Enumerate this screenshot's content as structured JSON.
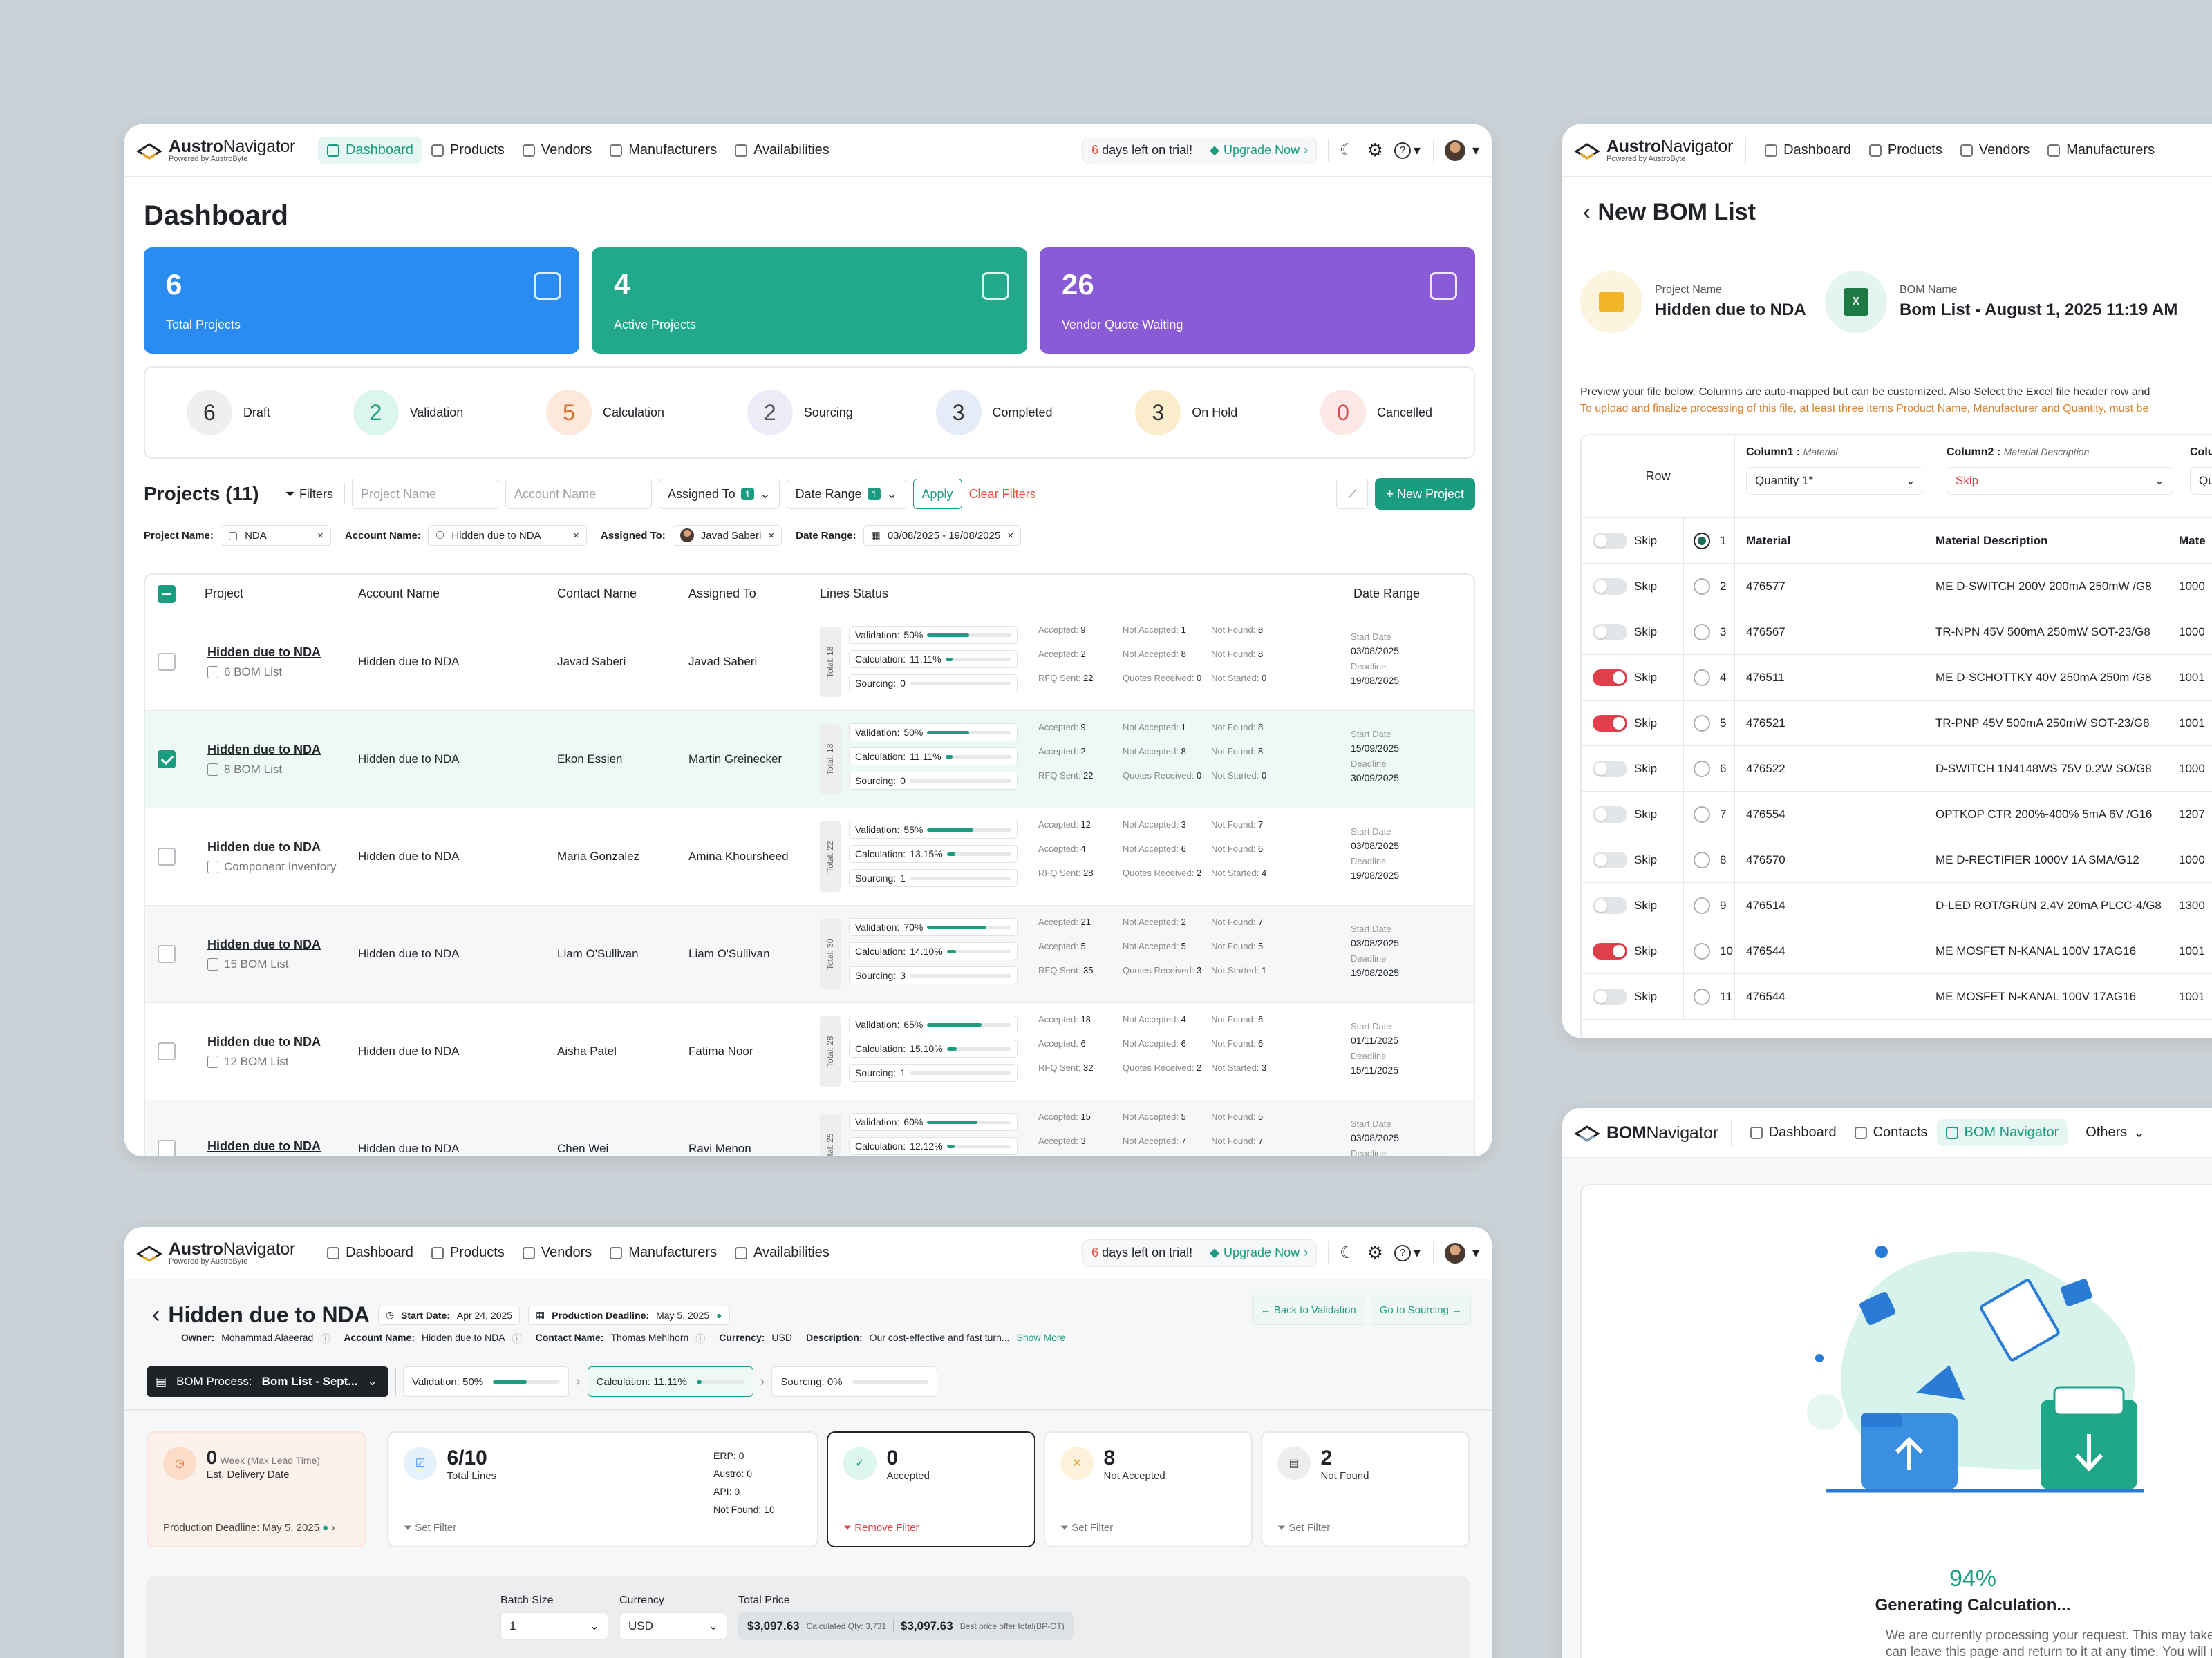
{
  "brand": {
    "name": "AustroNavigator",
    "name_a": "Austro",
    "name_b": "Navigator",
    "powered": "Powered by AustroByte",
    "bom_a": "BOM",
    "bom_b": "Navigator"
  },
  "nav": {
    "dashboard": "Dashboard",
    "products": "Products",
    "vendors": "Vendors",
    "manufacturers": "Manufacturers",
    "availabilities": "Availabilities",
    "contacts": "Contacts",
    "bom_navigator": "BOM Navigator",
    "others": "Others"
  },
  "trial": {
    "days": "6",
    "text": "days left on trial!",
    "upgrade": "Upgrade Now"
  },
  "dashboard": {
    "title": "Dashboard",
    "stats": [
      {
        "value": "6",
        "label": "Total Projects",
        "color": "#2a8cf0"
      },
      {
        "value": "4",
        "label": "Active Projects",
        "color": "#22a88b"
      },
      {
        "value": "26",
        "label": "Vendor Quote Waiting",
        "color": "#8a5bd6"
      }
    ],
    "statuses": [
      {
        "value": "6",
        "label": "Draft",
        "bg": "#eeeff1",
        "fg": "#333"
      },
      {
        "value": "2",
        "label": "Validation",
        "bg": "#dcf6ee",
        "fg": "#1a9c80"
      },
      {
        "value": "5",
        "label": "Calculation",
        "bg": "#fde9dc",
        "fg": "#d9692b"
      },
      {
        "value": "2",
        "label": "Sourcing",
        "bg": "#ecebf8",
        "fg": "#555"
      },
      {
        "value": "3",
        "label": "Completed",
        "bg": "#e6ebf8",
        "fg": "#333"
      },
      {
        "value": "3",
        "label": "On Hold",
        "bg": "#fbeccb",
        "fg": "#333"
      },
      {
        "value": "0",
        "label": "Cancelled",
        "bg": "#fde8e8",
        "fg": "#d94848"
      }
    ],
    "projects_title": "Projects (11)",
    "filters": "Filters",
    "project_name_ph": "Project Name",
    "account_name_ph": "Account Name",
    "assigned_to": "Assigned To",
    "assigned_badge": "1",
    "date_range": "Date Range",
    "date_badge": "1",
    "apply": "Apply",
    "clear": "Clear Filters",
    "new_project": "+ New Project",
    "chips": {
      "project_label": "Project Name:",
      "project_val": "NDA",
      "account_label": "Account Name:",
      "account_val": "Hidden due to NDA",
      "assigned_label": "Assigned To:",
      "assigned_val": "Javad Saberi",
      "date_label": "Date Range:",
      "date_val": "03/08/2025 - 19/08/2025"
    },
    "headers": {
      "project": "Project",
      "account": "Account Name",
      "contact": "Contact Name",
      "assigned": "Assigned To",
      "lines": "Lines Status",
      "date": "Date Range"
    },
    "line_labels": {
      "accepted": "Accepted:",
      "not_accepted": "Not Accepted:",
      "not_found": "Not Found:",
      "rfq": "RFQ Sent:",
      "quotes": "Quotes Received:",
      "not_started": "Not Started:",
      "validation": "Validation:",
      "calculation": "Calculation:",
      "sourcing": "Sourcing:",
      "start": "Start Date",
      "deadline": "Deadline"
    },
    "rows": [
      {
        "name": "Hidden due to NDA",
        "sub": "6 BOM List",
        "account": "Hidden due to NDA",
        "contact": "Javad Saberi",
        "assigned": "Javad Saberi",
        "total": "Total: 18",
        "val": "50%",
        "val_f": 0.5,
        "calc": "11.11%",
        "calc_f": 0.11,
        "src": "0",
        "src_f": 0,
        "acc1": "9",
        "na1": "1",
        "nf1": "8",
        "acc2": "2",
        "na2": "8",
        "nf2": "8",
        "rfq": "22",
        "qr": "0",
        "ns": "0",
        "start": "03/08/2025",
        "deadline": "19/08/2025",
        "checked": false
      },
      {
        "name": "Hidden due to NDA",
        "sub": "8 BOM List",
        "account": "Hidden due to NDA",
        "contact": "Ekon Essien",
        "assigned": "Martin Greinecker",
        "total": "Total: 18",
        "val": "50%",
        "val_f": 0.5,
        "calc": "11.11%",
        "calc_f": 0.11,
        "src": "0",
        "src_f": 0,
        "acc1": "9",
        "na1": "1",
        "nf1": "8",
        "acc2": "2",
        "na2": "8",
        "nf2": "8",
        "rfq": "22",
        "qr": "0",
        "ns": "0",
        "start": "15/09/2025",
        "deadline": "30/09/2025",
        "checked": true
      },
      {
        "name": "Hidden due to NDA",
        "sub": "Component Inventory",
        "account": "Hidden due to NDA",
        "contact": "Maria Gonzalez",
        "assigned": "Amina Khoursheed",
        "total": "Total: 22",
        "val": "55%",
        "val_f": 0.55,
        "calc": "13.15%",
        "calc_f": 0.13,
        "src": "1",
        "src_f": 0,
        "acc1": "12",
        "na1": "3",
        "nf1": "7",
        "acc2": "4",
        "na2": "6",
        "nf2": "6",
        "rfq": "28",
        "qr": "2",
        "ns": "4",
        "start": "03/08/2025",
        "deadline": "19/08/2025",
        "checked": false
      },
      {
        "name": "Hidden due to NDA",
        "sub": "15 BOM List",
        "account": "Hidden due to NDA",
        "contact": "Liam O'Sullivan",
        "assigned": "Liam O'Sullivan",
        "total": "Total: 30",
        "val": "70%",
        "val_f": 0.7,
        "calc": "14.10%",
        "calc_f": 0.14,
        "src": "3",
        "src_f": 0,
        "acc1": "21",
        "na1": "2",
        "nf1": "7",
        "acc2": "5",
        "na2": "5",
        "nf2": "5",
        "rfq": "35",
        "qr": "3",
        "ns": "1",
        "start": "03/08/2025",
        "deadline": "19/08/2025",
        "checked": false
      },
      {
        "name": "Hidden due to NDA",
        "sub": "12 BOM List",
        "account": "Hidden due to NDA",
        "contact": "Aisha Patel",
        "assigned": "Fatima Noor",
        "total": "Total: 28",
        "val": "65%",
        "val_f": 0.65,
        "calc": "15.10%",
        "calc_f": 0.15,
        "src": "1",
        "src_f": 0,
        "acc1": "18",
        "na1": "4",
        "nf1": "6",
        "acc2": "6",
        "na2": "6",
        "nf2": "6",
        "rfq": "32",
        "qr": "2",
        "ns": "3",
        "start": "01/11/2025",
        "deadline": "15/11/2025",
        "checked": false
      },
      {
        "name": "Hidden due to NDA",
        "sub": "",
        "account": "Hidden due to NDA",
        "contact": "Chen Wei",
        "assigned": "Ravi Menon",
        "total": "Total: 25",
        "val": "60%",
        "val_f": 0.6,
        "calc": "12.12%",
        "calc_f": 0.12,
        "src": "",
        "src_f": 0,
        "acc1": "15",
        "na1": "5",
        "nf1": "5",
        "acc2": "3",
        "na2": "7",
        "nf2": "7",
        "rfq": "",
        "qr": "",
        "ns": "",
        "start": "03/08/2025",
        "deadline": "",
        "checked": false
      }
    ]
  },
  "bom": {
    "title": "New BOM List",
    "project_label": "Project Name",
    "project_val": "Hidden due to NDA",
    "bom_label": "BOM Name",
    "bom_val": "Bom List - August 1, 2025 11:19 AM",
    "note1": "Preview your file below. Columns are auto-mapped but can be customized. Also Select the Excel file header row and",
    "note2": "To upload and finalize processing of this file, at least three items Product Name, Manufacturer and Quantity, must be",
    "row_h": "Row",
    "col1": "Column1 :",
    "col1_sub": "Material",
    "col1_sel": "Quantity 1*",
    "col2": "Column2 :",
    "col2_sub": "Material Description",
    "col2_sel": "Skip",
    "col3": "Colu",
    "col3_sel": "Qu",
    "skip": "Skip",
    "rows": [
      {
        "n": "1",
        "mat": "Material",
        "desc": "Material Description",
        "m3": "Mate",
        "on": false,
        "radio": true,
        "head": true
      },
      {
        "n": "2",
        "mat": "476577",
        "desc": "ME D-SWITCH 200V 200mA 250mW /G8",
        "m3": "1000",
        "on": false,
        "radio": false
      },
      {
        "n": "3",
        "mat": "476567",
        "desc": "TR-NPN 45V 500mA 250mW SOT-23/G8",
        "m3": "1000",
        "on": false,
        "radio": false
      },
      {
        "n": "4",
        "mat": "476511",
        "desc": "ME D-SCHOTTKY 40V 250mA 250m /G8",
        "m3": "1001",
        "on": true,
        "radio": false
      },
      {
        "n": "5",
        "mat": "476521",
        "desc": "TR-PNP 45V 500mA 250mW SOT-23/G8",
        "m3": "1001",
        "on": true,
        "radio": false
      },
      {
        "n": "6",
        "mat": "476522",
        "desc": "D-SWITCH 1N4148WS 75V 0.2W SO/G8",
        "m3": "1000",
        "on": false,
        "radio": false
      },
      {
        "n": "7",
        "mat": "476554",
        "desc": "OPTKOP CTR 200%-400% 5mA 6V /G16",
        "m3": "1207",
        "on": false,
        "radio": false
      },
      {
        "n": "8",
        "mat": "476570",
        "desc": "ME D-RECTIFIER 1000V 1A SMA/G12",
        "m3": "1000",
        "on": false,
        "radio": false
      },
      {
        "n": "9",
        "mat": "476514",
        "desc": "D-LED ROT/GRÜN 2.4V 20mA PLCC-4/G8",
        "m3": "1300",
        "on": false,
        "radio": false
      },
      {
        "n": "10",
        "mat": "476544",
        "desc": "ME MOSFET N-KANAL 100V 17AG16",
        "m3": "1001",
        "on": true,
        "radio": false
      },
      {
        "n": "11",
        "mat": "476544",
        "desc": "ME MOSFET N-KANAL 100V 17AG16",
        "m3": "1001",
        "on": false,
        "radio": false
      }
    ]
  },
  "detail": {
    "title": "Hidden due to NDA",
    "start_label": "Start Date:",
    "start_val": "Apr 24, 2025",
    "deadline_label": "Production Deadline:",
    "deadline_val": "May 5, 2025",
    "back_validation": "← Back to Validation",
    "go_sourcing": "Go to Sourcing →",
    "owner_label": "Owner:",
    "owner": "Mohammad Alaeerad",
    "acc_label": "Account Name:",
    "acc": "Hidden due to NDA",
    "contact_label": "Contact Name:",
    "contact": "Thomas Mehlhorn",
    "cur_label": "Currency:",
    "cur": "USD",
    "desc_label": "Description:",
    "desc": "Our cost-effective and fast turn...",
    "show_more": "Show More",
    "bom_process": "BOM Process:",
    "bom_process_val": "Bom List - Sept...",
    "steps": [
      {
        "label": "Validation: 50%",
        "f": 0.5
      },
      {
        "label": "Calculation: 11.11%",
        "f": 0.11
      },
      {
        "label": "Sourcing: 0%",
        "f": 0
      }
    ],
    "delivery": {
      "n": "0",
      "unit": "Week (Max Lead Time)",
      "label": "Est. Delivery Date",
      "foot": "Production Deadline:",
      "foot_val": "May 5, 2025"
    },
    "total_lines": {
      "n": "6/10",
      "label": "Total Lines",
      "erp": "ERP: 0",
      "austro": "Austro: 0",
      "api": "API: 0",
      "nf": "Not Found: 10",
      "foot": "Set Filter"
    },
    "accepted": {
      "n": "0",
      "label": "Accepted",
      "foot": "Remove Filter"
    },
    "not_accepted": {
      "n": "8",
      "label": "Not Accepted",
      "foot": "Set Filter"
    },
    "not_found": {
      "n": "2",
      "label": "Not Found",
      "foot": "Set Filter"
    },
    "batch_label": "Batch Size",
    "batch_val": "1",
    "currency_label": "Currency",
    "currency_val": "USD",
    "price_label": "Total Price",
    "price1": "$3,097.63",
    "price1_sub": "Calculated Qty: 3,731",
    "price2": "$3,097.63",
    "price2_sub": "Best price offer total(BP-OT)"
  },
  "calc": {
    "percent": "94%",
    "title": "Generating Calculation...",
    "text1": "We are currently processing your request. This may take a few moments",
    "text2": "can leave this page and return to it at any time. You will receive a notific"
  }
}
